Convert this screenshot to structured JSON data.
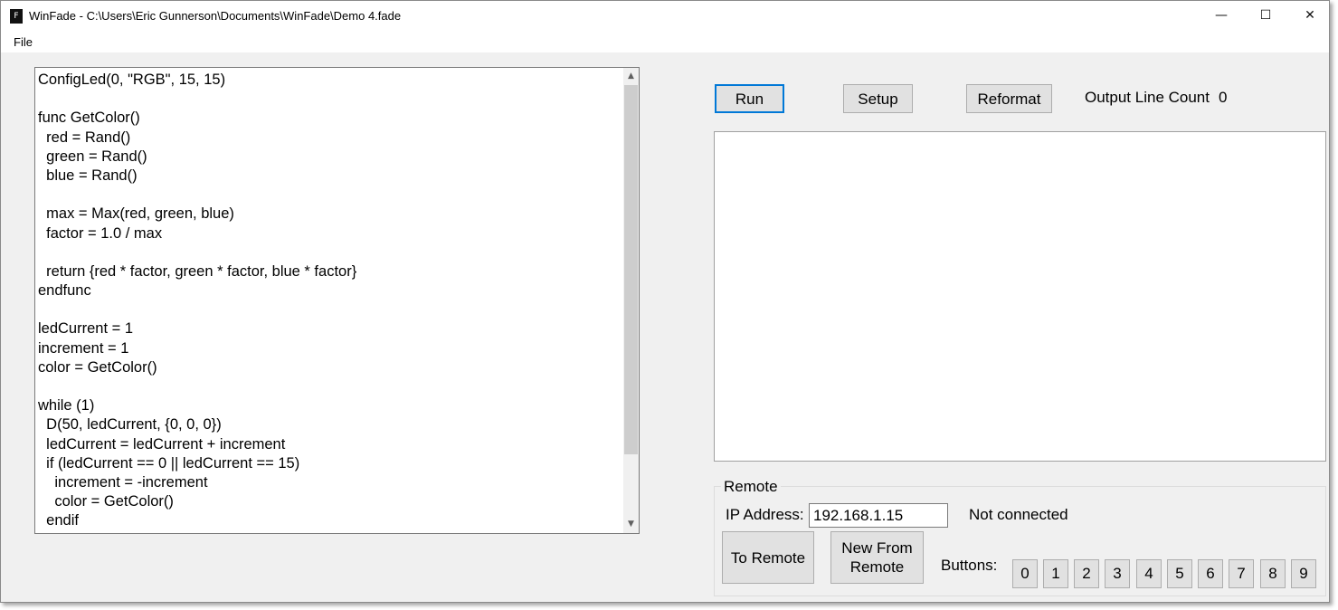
{
  "window": {
    "title": "WinFade - C:\\Users\\Eric Gunnerson\\Documents\\WinFade\\Demo 4.fade",
    "minimize_glyph": "—",
    "maximize_glyph": "☐",
    "close_glyph": "✕"
  },
  "menu": {
    "items": [
      {
        "label": "File"
      }
    ]
  },
  "editor": {
    "lines": [
      "ConfigLed(0, \"RGB\", 15, 15)",
      "",
      "func GetColor()",
      "  red = Rand()",
      "  green = Rand()",
      "  blue = Rand()",
      "",
      "  max = Max(red, green, blue)",
      "  factor = 1.0 / max",
      "",
      "  return {red * factor, green * factor, blue * factor}",
      "endfunc",
      "",
      "ledCurrent = 1",
      "increment = 1",
      "color = GetColor()",
      "",
      "while (1)",
      "  D(50, ledCurrent, {0, 0, 0})",
      "  ledCurrent = ledCurrent + increment",
      "  if (ledCurrent == 0 || ledCurrent == 15)",
      "    increment = -increment",
      "    color = GetColor()",
      "  endif"
    ],
    "scroll_up_glyph": "▲",
    "scroll_down_glyph": "▼"
  },
  "toolbar": {
    "run_label": "Run",
    "setup_label": "Setup",
    "reformat_label": "Reformat",
    "output_line_count_label": "Output Line Count",
    "output_line_count_value": "0"
  },
  "output": {
    "text": ""
  },
  "remote": {
    "group_title": "Remote",
    "ip_label": "IP Address:",
    "ip_value": "192.168.1.15",
    "status": "Not connected",
    "to_remote_label": "To Remote",
    "new_from_remote_line1": "New From",
    "new_from_remote_line2": "Remote",
    "buttons_label": "Buttons:",
    "buttons": [
      "0",
      "1",
      "2",
      "3",
      "4",
      "5",
      "6",
      "7",
      "8",
      "9"
    ]
  },
  "colors": {
    "window_bg": "#f0f0f0",
    "button_bg": "#e1e1e1",
    "focus_border": "#0078d7"
  }
}
